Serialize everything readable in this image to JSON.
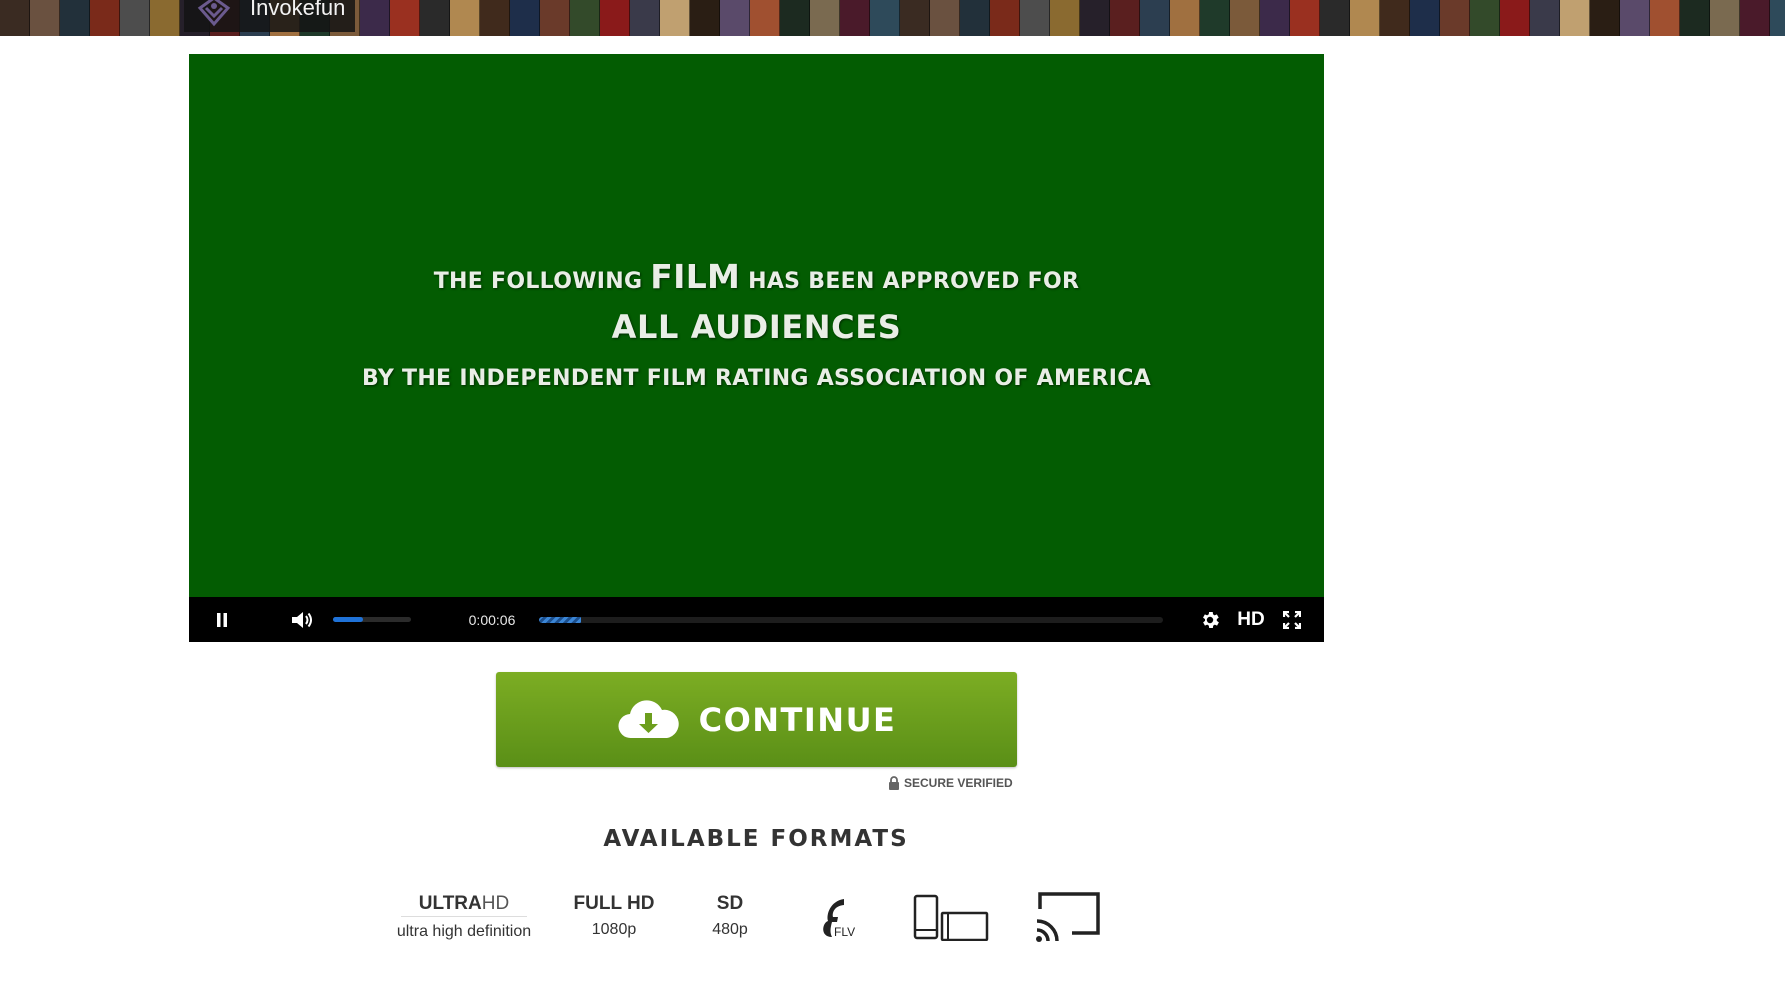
{
  "banner": {
    "brand_name": "Invokefun",
    "poster_colors": [
      "#3a2b22",
      "#6a5140",
      "#22303a",
      "#7a2a1a",
      "#4d4d4d",
      "#8a6a30",
      "#26202a",
      "#5a1f1f",
      "#2c3e50",
      "#a07040",
      "#1f3a2a",
      "#7b5a3a",
      "#3c2a4a",
      "#9a3020",
      "#2a2a2a",
      "#b08850",
      "#402a1c",
      "#1e2e4a",
      "#6a3a2a",
      "#334a2a",
      "#8a1a1a",
      "#3a3a4a",
      "#c0a070",
      "#2a1e14",
      "#5a4a6a",
      "#a05030",
      "#1c2a20",
      "#7a6a50",
      "#4a1a2a",
      "#2e4a5a"
    ]
  },
  "player": {
    "overlay_line1_a": "THE FOLLOWING ",
    "overlay_line1_b": "FILM",
    "overlay_line1_c": " HAS BEEN APPROVED FOR",
    "overlay_line2": "ALL AUDIENCES",
    "overlay_line3": "BY THE INDEPENDENT FILM RATING ASSOCIATION OF AMERICA",
    "time": "0:00:06",
    "quality_label": "HD",
    "volume_fraction": 0.38,
    "progress_fraction": 0.067,
    "background_color": "#035c02",
    "accent_color": "#1f72d8",
    "icons": [
      "pause-icon",
      "volume-icon",
      "gear-icon",
      "fullscreen-icon"
    ]
  },
  "cta": {
    "label": "CONTINUE",
    "icon": "cloud-download-icon",
    "color": "#6c9e1d",
    "secure_label": "SECURE VERIFIED",
    "secure_icon": "lock-icon"
  },
  "formats": {
    "title": "AVAILABLE FORMATS",
    "items": [
      {
        "title_bold": "ULTRA",
        "title_thin": "HD",
        "subtitle": "ultra high definition"
      },
      {
        "title": "FULL HD",
        "subtitle": "1080p"
      },
      {
        "title": "SD",
        "subtitle": "480p"
      },
      {
        "icon": "flash-flv-icon",
        "text": "FLV"
      },
      {
        "icon": "devices-icon"
      },
      {
        "icon": "cast-icon"
      }
    ]
  }
}
